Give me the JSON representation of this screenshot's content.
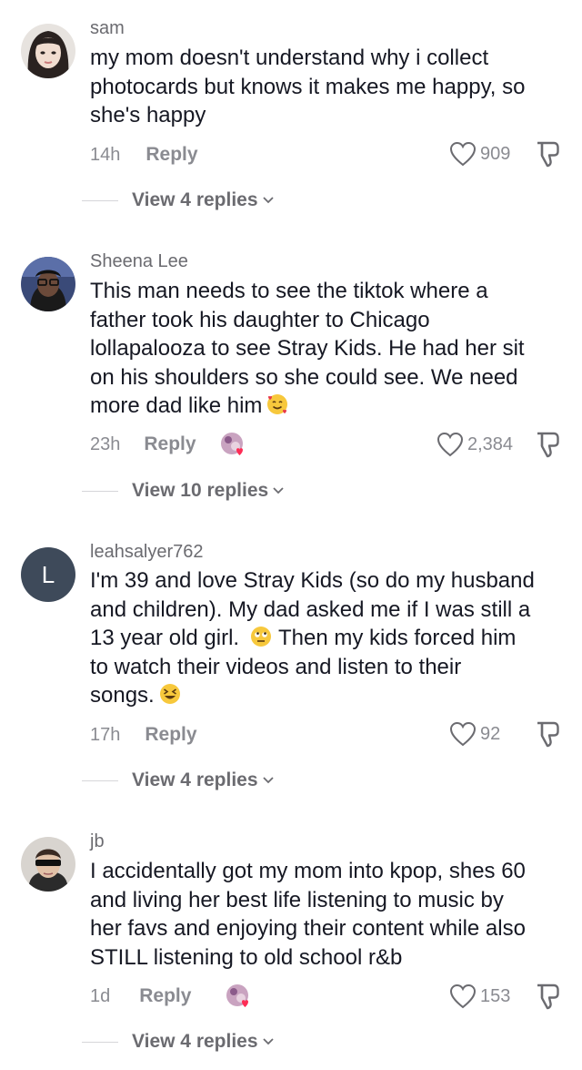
{
  "comments": [
    {
      "username": "sam",
      "text_lines": [
        "my mom doesn't understand why i collect",
        "photocards but knows it makes me happy, so",
        "she's happy"
      ],
      "time": "14h",
      "reply_label": "Reply",
      "likes": "909",
      "view_replies": "View 4 replies"
    },
    {
      "username": "Sheena Lee",
      "text_lines": [
        "This man needs to see the tiktok where a",
        "father took his daughter to Chicago",
        "lollapalooza to see Stray Kids. He had her sit",
        "on his shoulders so she could see. We need",
        "more dad like him"
      ],
      "time": "23h",
      "reply_label": "Reply",
      "likes": "2,384",
      "view_replies": "View 10 replies"
    },
    {
      "username": "leahsalyer762",
      "avatar_letter": "L",
      "text_lines": [
        "I'm 39 and love Stray Kids (so do my husband",
        "and children). My dad asked me if I was still a",
        "13 year old girl.",
        "Then my kids forced him",
        "to watch their videos and listen to their",
        "songs."
      ],
      "time": "17h",
      "reply_label": "Reply",
      "likes": "92",
      "view_replies": "View 4 replies"
    },
    {
      "username": "jb",
      "text_lines": [
        "I accidentally got my mom into kpop, shes 60",
        "and living her best life listening to music by",
        "her favs and enjoying their content while also",
        "STILL listening to old school r&b"
      ],
      "time": "1d",
      "reply_label": "Reply",
      "likes": "153",
      "view_replies": "View 4 replies"
    }
  ],
  "icons": {
    "like": "heart-outline-icon",
    "dislike": "thumbs-down-outline-icon",
    "chevron": "chevron-down-icon"
  },
  "colors": {
    "text": "#161823",
    "secondary": "#8a8b91",
    "avatar_letter_bg": "#3e4a5a"
  }
}
